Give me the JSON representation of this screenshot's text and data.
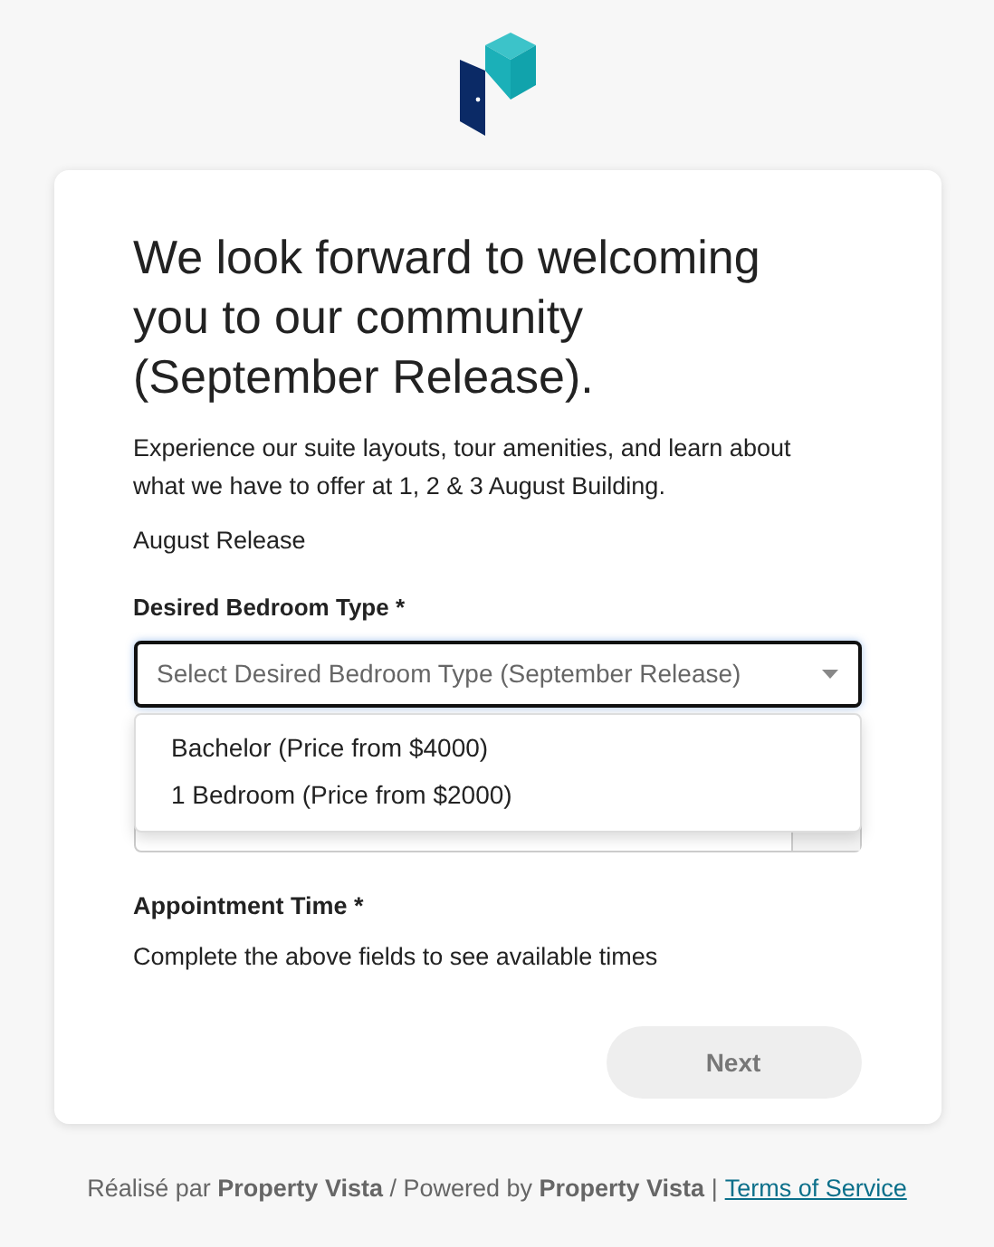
{
  "heading": "We look forward to welcoming you to our community (September Release).",
  "intro": "Experience our suite layouts, tour amenities, and learn about what we have to offer at 1, 2 & 3 August Building.",
  "release": "August Release",
  "bedroom_field": {
    "label": "Desired Bedroom Type *",
    "placeholder": "Select Desired Bedroom Type (September Release)",
    "expanded": true,
    "options": [
      {
        "label": "Bachelor (Price from $4000)"
      },
      {
        "label": "1 Bedroom (Price from $2000)"
      }
    ]
  },
  "appointment": {
    "label": "Appointment Time *",
    "note": "Complete the above fields to see available times"
  },
  "next_button": {
    "label": "Next",
    "disabled": true
  },
  "footer": {
    "text": "Réalisé par **Property Vista** / Powered by **Property Vista** |",
    "link": "Terms of Service"
  }
}
